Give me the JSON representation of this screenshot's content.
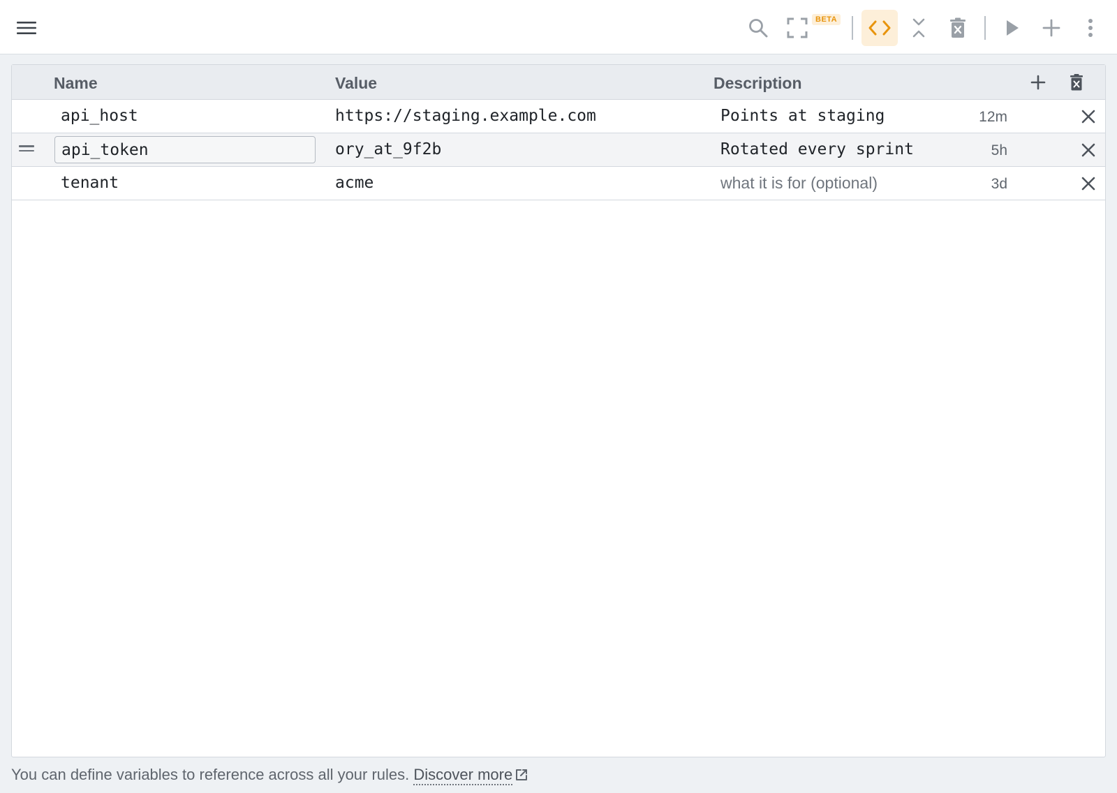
{
  "toolbar": {
    "menu_icon": "hamburger-menu-icon",
    "beta_badge": "BETA",
    "icons": [
      "search-icon",
      "fullscreen-icon",
      "code-icon",
      "collapse-icon",
      "delete-all-icon",
      "play-icon",
      "plus-icon",
      "more-vert-icon"
    ],
    "active_color": "#e8940c"
  },
  "table": {
    "headers": {
      "name": "Name",
      "value": "Value",
      "description": "Description"
    },
    "rows": [
      {
        "name": "api_host",
        "value": "https://staging.example.com",
        "description": "Points at staging",
        "age": "12m"
      },
      {
        "name": "api_token",
        "value": "ory_at_9f2b",
        "description": "Rotated every sprint",
        "age": "5h"
      },
      {
        "name": "tenant",
        "value": "acme",
        "description": "",
        "description_placeholder": "what it is for (optional)",
        "age": "3d"
      }
    ]
  },
  "footer": {
    "text": "You can define variables to reference across all your rules.",
    "link_label": "Discover more"
  }
}
